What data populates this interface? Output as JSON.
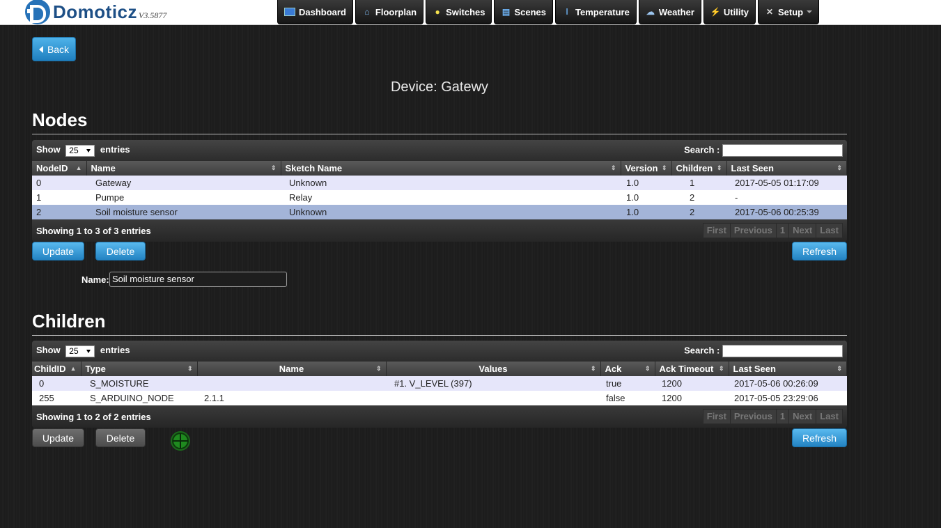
{
  "app": {
    "name": "Domoticz",
    "version": "V3.5877"
  },
  "nav": [
    {
      "label": "Dashboard",
      "icon": "dashboard-icon"
    },
    {
      "label": "Floorplan",
      "icon": "floorplan-icon"
    },
    {
      "label": "Switches",
      "icon": "lightbulb-icon"
    },
    {
      "label": "Scenes",
      "icon": "clapperboard-icon"
    },
    {
      "label": "Temperature",
      "icon": "thermometer-icon"
    },
    {
      "label": "Weather",
      "icon": "weather-icon"
    },
    {
      "label": "Utility",
      "icon": "utility-icon"
    },
    {
      "label": "Setup",
      "icon": "tools-icon"
    }
  ],
  "back_label": "Back",
  "device_title": "Device: Gatewy",
  "nodes": {
    "title": "Nodes",
    "show_label": "Show",
    "entries_label": "entries",
    "page_size": "25",
    "search_label": "Search :",
    "columns": [
      "NodeID",
      "Name",
      "Sketch Name",
      "Version",
      "Children",
      "Last Seen"
    ],
    "rows": [
      [
        "0",
        "Gateway",
        "Unknown",
        "1.0",
        "1",
        "2017-05-05 01:17:09"
      ],
      [
        "1",
        "Pumpe",
        "Relay",
        "1.0",
        "2",
        "-"
      ],
      [
        "2",
        "Soil moisture sensor",
        "Unknown",
        "1.0",
        "2",
        "2017-05-06 00:25:39"
      ]
    ],
    "info": "Showing 1 to 3 of 3 entries",
    "pager": [
      "First",
      "Previous",
      "1",
      "Next",
      "Last"
    ],
    "update_label": "Update",
    "delete_label": "Delete",
    "refresh_label": "Refresh",
    "name_label": "Name:",
    "name_value": "Soil moisture sensor"
  },
  "children": {
    "title": "Children",
    "show_label": "Show",
    "entries_label": "entries",
    "page_size": "25",
    "search_label": "Search :",
    "columns": [
      "ChildID",
      "Type",
      "Name",
      "Values",
      "Ack",
      "Ack Timeout",
      "Last Seen"
    ],
    "rows": [
      [
        "0",
        "S_MOISTURE",
        "",
        "#1. V_LEVEL (397)",
        "true",
        "1200",
        "2017-05-06 00:26:09"
      ],
      [
        "255",
        "S_ARDUINO_NODE",
        "2.1.1",
        "",
        "false",
        "1200",
        "2017-05-05 23:29:06"
      ]
    ],
    "info": "Showing 1 to 2 of 2 entries",
    "pager": [
      "First",
      "Previous",
      "1",
      "Next",
      "Last"
    ],
    "update_label": "Update",
    "delete_label": "Delete",
    "refresh_label": "Refresh"
  },
  "colors": {
    "accent": "#2383c2",
    "selected_row": "#a3b4d8",
    "odd_row": "#e6e6fa"
  }
}
